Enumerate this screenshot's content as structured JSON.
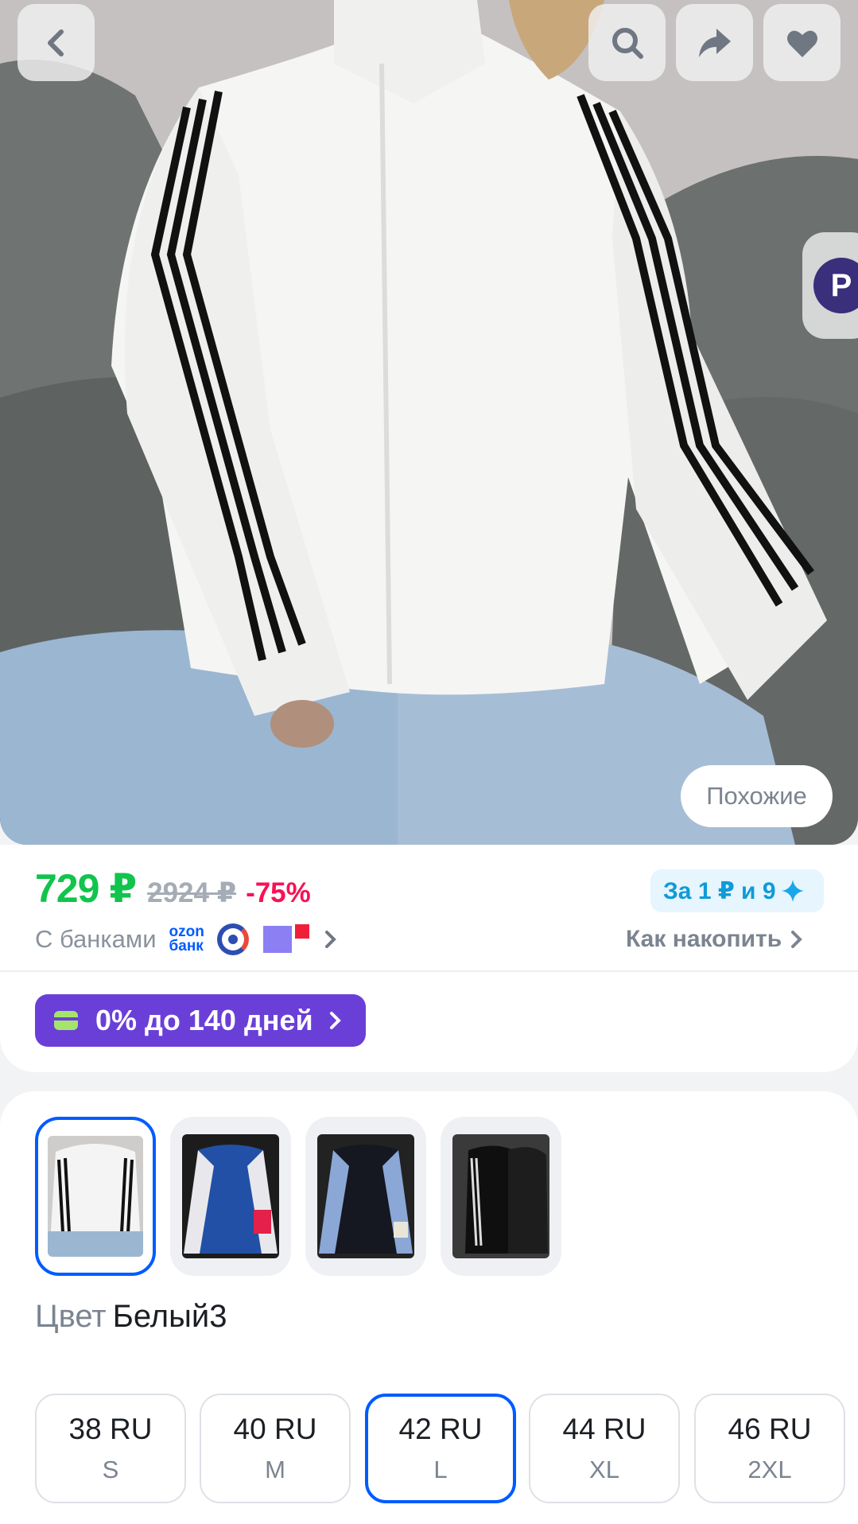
{
  "header": {
    "back_icon": "chevron-left-icon",
    "search_icon": "search-icon",
    "share_icon": "share-arrow-icon",
    "favorite_icon": "heart-icon"
  },
  "gallery": {
    "side_tab_letter": "P",
    "similar_label": "Похожие"
  },
  "price": {
    "current": "729 ₽",
    "old": "2924 ₽",
    "discount": "-75%",
    "points_badge": "За 1 ₽ и 9",
    "banks_label": "С банками",
    "ozon_bank_line1": "ozon",
    "ozon_bank_line2": "банк",
    "accumulate_link": "Как накопить"
  },
  "installment": {
    "label": "0% до 140 дней"
  },
  "variants": {
    "color_label": "Цвет",
    "color_value": "Белый3",
    "sizes": [
      {
        "ru": "38 RU",
        "intl": "S"
      },
      {
        "ru": "40 RU",
        "intl": "M"
      },
      {
        "ru": "42 RU",
        "intl": "L"
      },
      {
        "ru": "44 RU",
        "intl": "XL"
      },
      {
        "ru": "46 RU",
        "intl": "2XL"
      }
    ]
  },
  "colors": {
    "price_green": "#10c44c",
    "discount_red": "#f91155",
    "accent_blue": "#005bff",
    "installment_purple": "#6a3fd8"
  }
}
